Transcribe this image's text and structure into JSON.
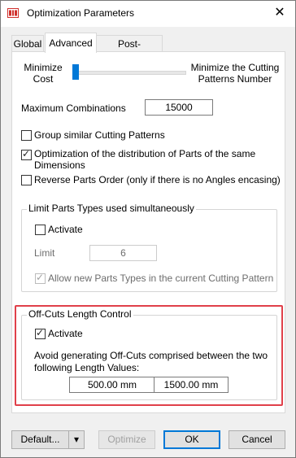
{
  "window": {
    "title": "Optimization Parameters",
    "close_glyph": "✕"
  },
  "tabs": [
    {
      "label": "Global"
    },
    {
      "label": "Advanced"
    },
    {
      "label": "Post-Processor"
    }
  ],
  "slider": {
    "left_label": "Minimize\nCost",
    "right_label": "Minimize the Cutting\nPatterns Number",
    "position_fraction": 0.0
  },
  "max_combinations": {
    "label": "Maximum Combinations",
    "value": "15000"
  },
  "options": {
    "group_similar": {
      "label": "Group similar Cutting Patterns",
      "checked": false
    },
    "optimize_distribution": {
      "label": "Optimization of the distribution of Parts of the same\nDimensions",
      "checked": true
    },
    "reverse_order": {
      "label": "Reverse Parts Order (only if there is no Angles encasing)",
      "checked": false
    }
  },
  "limit_types": {
    "title": "Limit Parts Types used simultaneously",
    "activate_label": "Activate",
    "activate_checked": false,
    "limit_label": "Limit",
    "limit_value": "6",
    "allow_new_label": "Allow new Parts Types in the current Cutting Pattern",
    "allow_new_checked": true
  },
  "offcuts": {
    "title": "Off-Cuts Length Control",
    "activate_label": "Activate",
    "activate_checked": true,
    "description": "Avoid generating Off-Cuts comprised between the two\nfollowing Length Values:",
    "min_value": "500.00 mm",
    "max_value": "1500.00 mm"
  },
  "buttons": {
    "default_label": "Default...",
    "dropdown_glyph": "▾",
    "optimize_label": "Optimize",
    "ok_label": "OK",
    "cancel_label": "Cancel"
  },
  "colors": {
    "highlight_frame": "#e0404a",
    "slider_thumb": "#0078d7"
  }
}
